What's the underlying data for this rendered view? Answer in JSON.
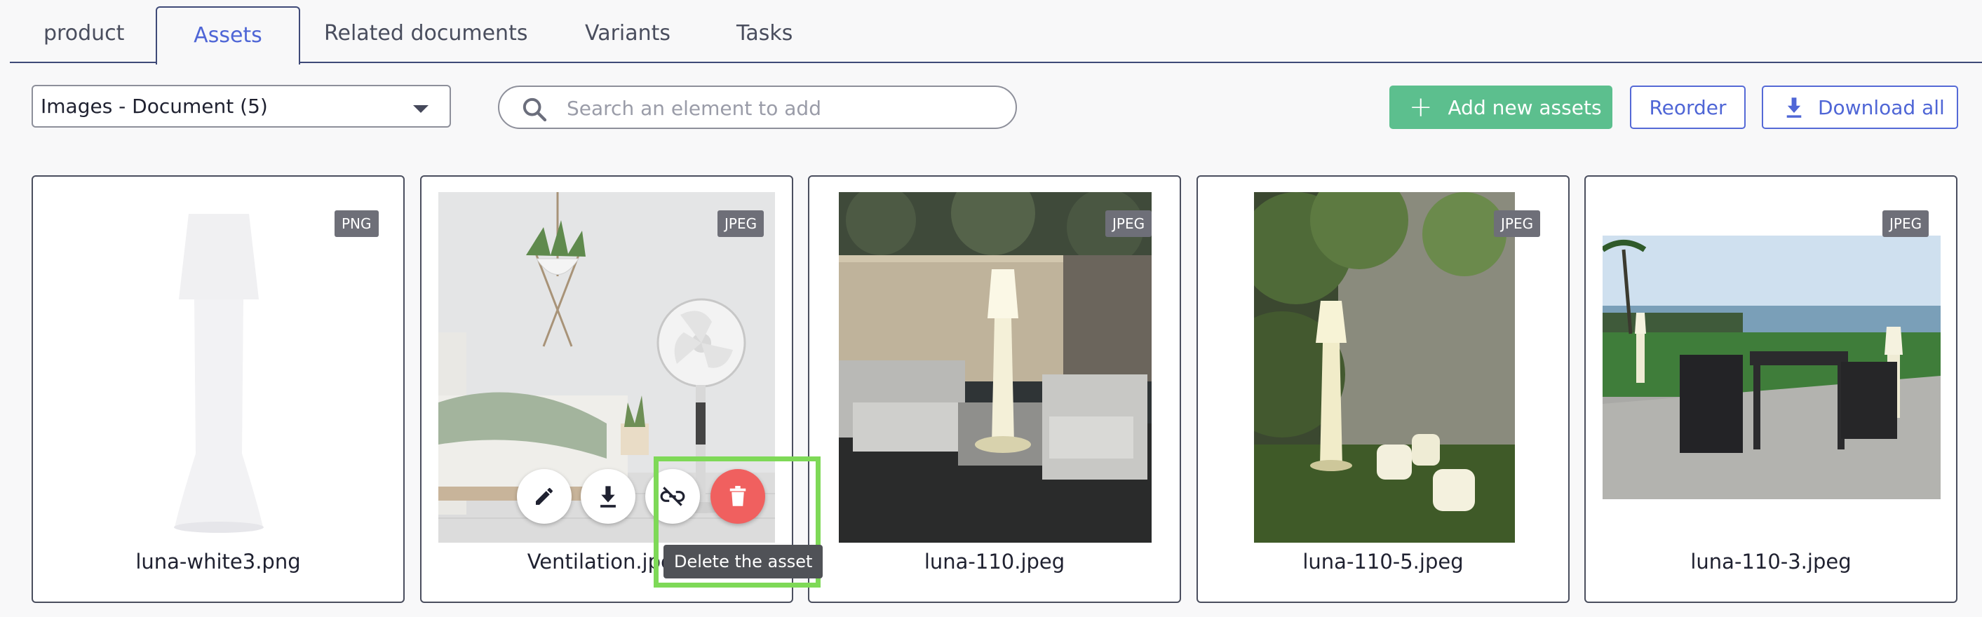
{
  "tabs": [
    {
      "label": "product"
    },
    {
      "label": "Assets"
    },
    {
      "label": "Related documents"
    },
    {
      "label": "Variants"
    },
    {
      "label": "Tasks"
    }
  ],
  "active_tab": "Assets",
  "toolbar": {
    "select_value": "Images - Document (5)",
    "search_placeholder": "Search an element to add",
    "add_label": "Add new assets",
    "reorder_label": "Reorder",
    "download_label": "Download all"
  },
  "assets": [
    {
      "name": "luna-white3.png",
      "type": "PNG"
    },
    {
      "name": "Ventilation.jpeg",
      "type": "JPEG"
    },
    {
      "name": "luna-110.jpeg",
      "type": "JPEG"
    },
    {
      "name": "luna-110-5.jpeg",
      "type": "JPEG"
    },
    {
      "name": "luna-110-3.jpeg",
      "type": "JPEG"
    }
  ],
  "tooltip": "Delete the asset",
  "colors": {
    "accent": "#4f66d6",
    "add_button": "#5cbf8e",
    "delete_button": "#f0605f",
    "highlight": "#7ed957"
  }
}
